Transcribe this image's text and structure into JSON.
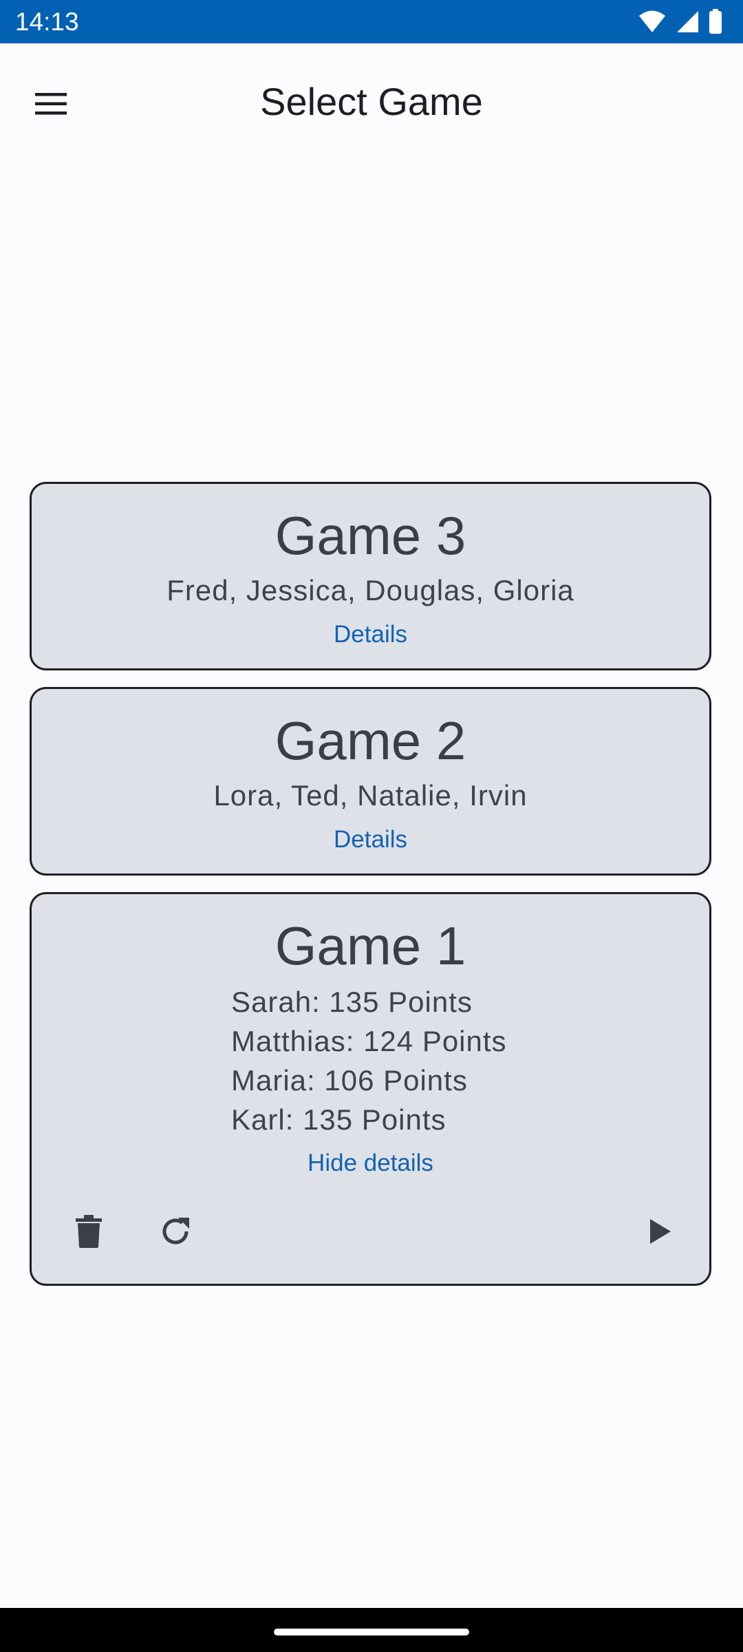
{
  "status_bar": {
    "time": "14:13",
    "icons": [
      "wifi-icon",
      "cellular-signal-icon",
      "battery-icon"
    ]
  },
  "app_bar": {
    "title": "Select Game",
    "menu_icon": "menu-icon"
  },
  "colors": {
    "status_bar": "#0261b3",
    "background": "#fcfbfe",
    "card_background": "#dfe1e9",
    "card_border": "#1e1f23",
    "link": "#1163b0",
    "text": "#3c3f47"
  },
  "games": [
    {
      "title": "Game 3",
      "players": "Fred, Jessica, Douglas, Gloria",
      "details_label": "Details",
      "expanded": false
    },
    {
      "title": "Game 2",
      "players": "Lora, Ted, Natalie, Irvin",
      "details_label": "Details",
      "expanded": false
    },
    {
      "title": "Game 1",
      "scores": [
        "Sarah: 135 Points",
        "Matthias: 124 Points",
        "Maria: 106 Points",
        "Karl: 135 Points"
      ],
      "details_label": "Hide details",
      "expanded": true,
      "actions": [
        "delete-icon",
        "restart-icon",
        "play-icon"
      ]
    }
  ]
}
